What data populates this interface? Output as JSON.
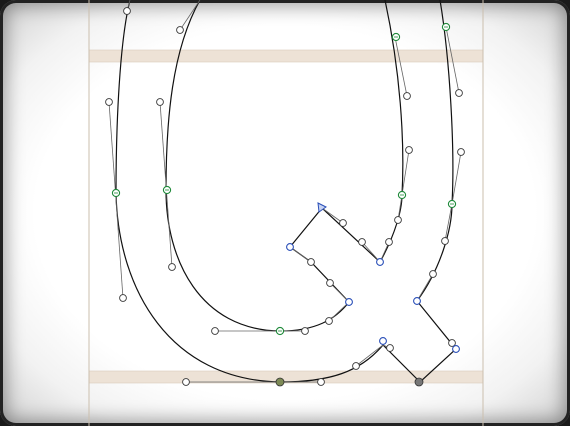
{
  "app": {
    "view": "glyph-outline-editor"
  },
  "glyph": {
    "name": "Q"
  },
  "colors": {
    "metric_band": "#ede2d6",
    "metric_border": "#d9cbbb",
    "sidebearing": "#cbbfae",
    "outline": "#111111",
    "handle_line": "#666666",
    "offcurve_point": "#3a3a3a",
    "smooth_point": "#1f8a3a",
    "corner_point": "#2a4fb8",
    "start_point": "#2a4fb8",
    "selected_point": "#6b7a4b",
    "vignette": "#1a1a1a"
  },
  "icons": {
    "start_point": "start-point-triangle-icon"
  }
}
